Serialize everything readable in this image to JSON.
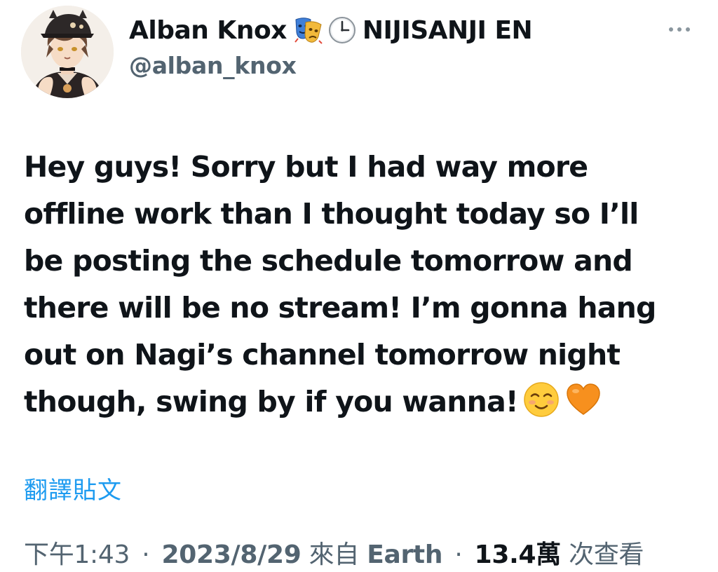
{
  "author": {
    "display_name": "Alban Knox",
    "emoji_1": "performing-arts-mask-icon",
    "emoji_2": "clock-icon",
    "affiliation": "NIJISANJI EN",
    "handle": "@alban_knox"
  },
  "more_menu_icon": "ellipsis-icon",
  "tweet": {
    "lines": [
      "Hey guys! Sorry but I had way more",
      "offline work than I thought today so I’ll",
      "be posting the schedule tomorrow and",
      "there will be no stream! I’m gonna hang",
      "out on Nagi’s channel tomorrow night",
      "though, swing by if you wanna!"
    ],
    "trailing_emojis": [
      "smiling-face-icon",
      "orange-heart-icon"
    ]
  },
  "translate_label": "翻譯貼文",
  "meta": {
    "time": "下午1:43",
    "separator": "·",
    "date": "2023/8/29",
    "source_prefix": "來自",
    "source": "Earth",
    "views_count": "13.4萬",
    "views_label": "次查看"
  },
  "colors": {
    "text": "#0f1419",
    "secondary": "#536471",
    "link": "#1d9bf0",
    "background": "#ffffff"
  }
}
